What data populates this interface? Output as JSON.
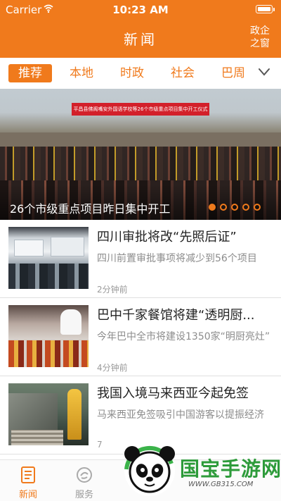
{
  "status_bar": {
    "carrier": "Carrier",
    "time": "10:23 AM"
  },
  "header": {
    "title": "新闻",
    "gov_line1": "政企",
    "gov_line2": "之窗"
  },
  "tabs": [
    {
      "label": "推荐",
      "active": true
    },
    {
      "label": "本地",
      "active": false
    },
    {
      "label": "时政",
      "active": false
    },
    {
      "label": "社会",
      "active": false
    },
    {
      "label": "巴周",
      "active": false
    }
  ],
  "hero": {
    "caption": "26个市级重点项目昨日集中开工",
    "banner_text": "平昌县佛阁嘴安外国语学校等26个市级重点项目集中开工仪式",
    "slides_total": 5,
    "active_slide": 1
  },
  "news": [
    {
      "title": "四川审批将改“先照后证”",
      "summary": "四川前置审批事项将减少到56个项目",
      "time": "2分钟前"
    },
    {
      "title": "巴中千家餐馆将建“透明厨...",
      "summary": "今年巴中全市将建设1350家“明厨亮灶”",
      "time": "4分钟前"
    },
    {
      "title": "我国入境马来西亚今起免签",
      "summary": "马来西亚免签吸引中国游客以提振经济",
      "time": "7"
    }
  ],
  "tabbar": [
    {
      "label": "新闻",
      "icon": "news-doc-icon",
      "active": true
    },
    {
      "label": "服务",
      "icon": "service-icon",
      "active": false
    }
  ],
  "watermark": {
    "name": "国宝手游网",
    "url": "WWW.GB315.COM"
  },
  "colors": {
    "accent": "#f07a1c",
    "watermark_green": "#2d9b3a"
  }
}
